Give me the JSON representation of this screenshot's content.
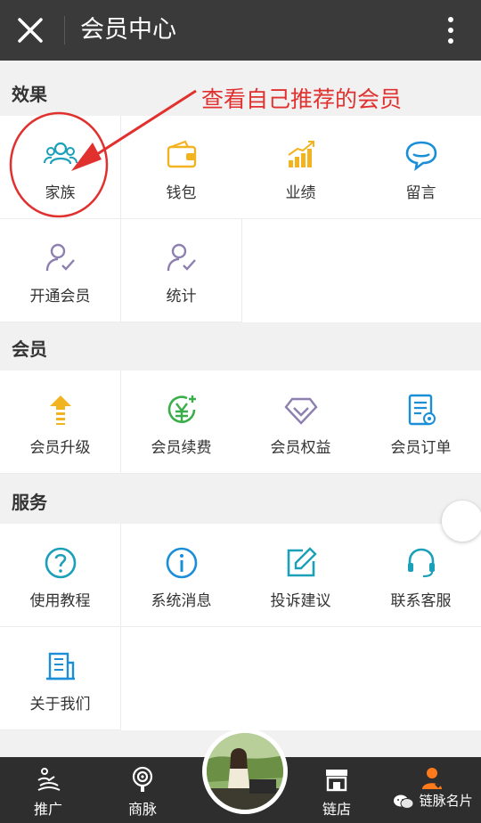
{
  "header": {
    "title": "会员中心",
    "close_icon": "close-icon",
    "more_icon": "more-vertical-icon"
  },
  "annotation": {
    "text": "查看自己推荐的会员",
    "color": "#e0312f"
  },
  "sections": [
    {
      "title": "效果",
      "items": [
        {
          "label": "家族",
          "icon": "family-icon",
          "color": "#1aa0b8"
        },
        {
          "label": "钱包",
          "icon": "wallet-icon",
          "color": "#f2b320"
        },
        {
          "label": "业绩",
          "icon": "performance-icon",
          "color": "#f2b320"
        },
        {
          "label": "留言",
          "icon": "message-icon",
          "color": "#1a8fd8"
        },
        {
          "label": "开通会员",
          "icon": "user-check-icon",
          "color": "#8d7fb0"
        },
        {
          "label": "统计",
          "icon": "statistics-icon",
          "color": "#8d7fb0"
        }
      ]
    },
    {
      "title": "会员",
      "items": [
        {
          "label": "会员升级",
          "icon": "upgrade-icon",
          "color": "#f2b320"
        },
        {
          "label": "会员续费",
          "icon": "renew-icon",
          "color": "#3aae4a"
        },
        {
          "label": "会员权益",
          "icon": "diamond-icon",
          "color": "#8d7fb0"
        },
        {
          "label": "会员订单",
          "icon": "order-icon",
          "color": "#1a8fd8"
        }
      ]
    },
    {
      "title": "服务",
      "items": [
        {
          "label": "使用教程",
          "icon": "help-icon",
          "color": "#1aa0b8"
        },
        {
          "label": "系统消息",
          "icon": "info-icon",
          "color": "#1a8fd8"
        },
        {
          "label": "投诉建议",
          "icon": "edit-icon",
          "color": "#1aa0b8"
        },
        {
          "label": "联系客服",
          "icon": "headset-icon",
          "color": "#1aa0b8"
        },
        {
          "label": "关于我们",
          "icon": "building-icon",
          "color": "#1a8fd8"
        }
      ]
    }
  ],
  "bottom_nav": [
    {
      "label": "推广",
      "icon": "promote-icon",
      "active": false
    },
    {
      "label": "商脉",
      "icon": "network-icon",
      "active": false
    },
    {
      "label": "链店",
      "icon": "store-icon",
      "active": false
    },
    {
      "label": "名片",
      "icon": "card-icon",
      "active": true
    }
  ],
  "watermark": {
    "text": "链脉名片"
  },
  "colors": {
    "header_bg": "#3a3a3a",
    "nav_bg": "#2e2e2e",
    "accent": "#ff7a1a"
  }
}
